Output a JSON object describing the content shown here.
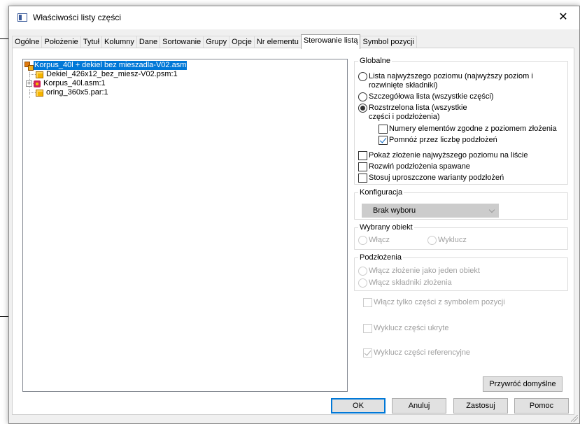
{
  "window": {
    "title": "Właściwości listy części",
    "close_glyph": "✕"
  },
  "tabs": [
    {
      "label": "Ogólne"
    },
    {
      "label": "Położenie"
    },
    {
      "label": "Tytuł"
    },
    {
      "label": "Kolumny"
    },
    {
      "label": "Dane"
    },
    {
      "label": "Sortowanie"
    },
    {
      "label": "Grupy"
    },
    {
      "label": "Opcje"
    },
    {
      "label": "Nr elementu"
    },
    {
      "label": "Sterowanie listą",
      "active": true
    },
    {
      "label": "Symbol pozycji"
    }
  ],
  "tree": {
    "root": {
      "label": "Korpus_40l + dekiel bez mieszadla-V02.asm",
      "icon": "assembly-icon",
      "selected": true
    },
    "children": [
      {
        "label": "Dekiel_426x12_bez_miesz-V02.psm:1",
        "icon": "part-icon"
      },
      {
        "label": "Korpus_40l.asm:1",
        "icon": "subassembly-icon",
        "expander": "+"
      },
      {
        "label": "oring_360x5.par:1",
        "icon": "part-icon"
      }
    ]
  },
  "globalne": {
    "title": "Globalne",
    "radio_top": "Lista najwyższego poziomu (najwyższy poziom i",
    "radio_top_2": "rozwinięte składniki)",
    "radio_detail": "Szczegółowa lista (wszystkie części)",
    "radio_exploded": "Rozstrzelona lista (wszystkie",
    "radio_exploded_2": "części i podzłożenia)",
    "check_numbers": "Numery elementów zgodne z poziomem złożenia",
    "check_multiply": "Pomnóż przez liczbę podzłożeń",
    "check_show_top": "Pokaż złożenie najwyższego poziomu na liście",
    "check_expand_weld": "Rozwiń podzłożenia spawane",
    "check_simplified": "Stosuj uproszczone warianty podzłożeń"
  },
  "konfiguracja": {
    "title": "Konfiguracja",
    "selected": "Brak wyboru"
  },
  "wybrany": {
    "title": "Wybrany obiekt",
    "include": "Włącz",
    "exclude": "Wyklucz"
  },
  "podzlozenia": {
    "title": "Podzłożenia",
    "as_one": "Włącz złożenie jako jeden obiekt",
    "components": "Włącz składniki złożenia"
  },
  "extra": {
    "only_symbol": "Włącz tylko części z symbolem pozycji",
    "exclude_hidden": "Wyklucz części ukryte",
    "exclude_ref": "Wyklucz części referencyjne"
  },
  "buttons": {
    "restore": "Przywróć domyślne",
    "ok": "OK",
    "cancel": "Anuluj",
    "apply": "Zastosuj",
    "help": "Pomoc"
  }
}
